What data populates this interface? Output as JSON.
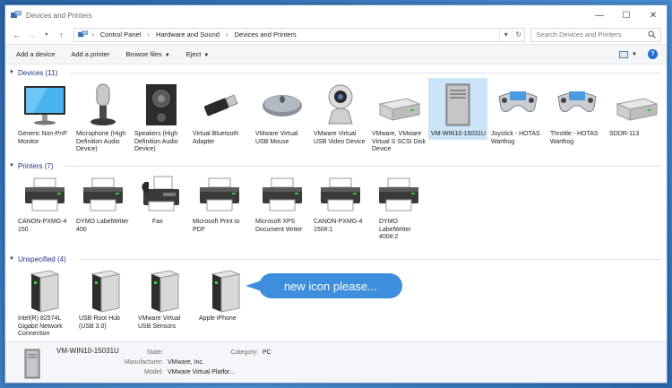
{
  "window": {
    "title": "Devices and Printers",
    "controls": {
      "minimize": "—",
      "maximize": "☐",
      "close": "✕"
    }
  },
  "address": {
    "crumbs": [
      "Control Panel",
      "Hardware and Sound",
      "Devices and Printers"
    ],
    "search_placeholder": "Search Devices and Printers"
  },
  "toolbar": {
    "add_device": "Add a device",
    "add_printer": "Add a printer",
    "browse_files": "Browse files",
    "eject": "Eject"
  },
  "groups": {
    "devices": {
      "header": "Devices (11)",
      "items": [
        {
          "label": "Generic Non-PnP Monitor",
          "icon": "monitor-icon"
        },
        {
          "label": "Microphone (High Definition Audio Device)",
          "icon": "microphone-icon"
        },
        {
          "label": "Speakers (High Definition Audio Device)",
          "icon": "speaker-icon"
        },
        {
          "label": "Virtual Bluetooth Adapter",
          "icon": "bluetooth-adapter-icon"
        },
        {
          "label": "VMware Virtual USB Mouse",
          "icon": "mouse-icon"
        },
        {
          "label": "VMware Virtual USB Video Device",
          "icon": "webcam-icon"
        },
        {
          "label": "VMware, VMware Virtual S SCSI Disk Device",
          "icon": "disk-drive-icon"
        },
        {
          "label": "VM-WIN10-15031U",
          "icon": "computer-tower-icon",
          "selected": true
        },
        {
          "label": "Joystick - HOTAS Warthog",
          "icon": "gamepad-icon"
        },
        {
          "label": "Throttle - HOTAS Warthog",
          "icon": "gamepad-icon"
        },
        {
          "label": "SDDR-113",
          "icon": "disk-drive-icon"
        }
      ]
    },
    "printers": {
      "header": "Printers (7)",
      "items": [
        {
          "label": "CANON-PXMG-4 150",
          "icon": "printer-icon"
        },
        {
          "label": "DYMO LabelWriter 400",
          "icon": "printer-icon"
        },
        {
          "label": "Fax",
          "icon": "fax-icon"
        },
        {
          "label": "Microsoft Print to PDF",
          "icon": "printer-icon"
        },
        {
          "label": "Microsoft XPS Document Writer",
          "icon": "printer-icon"
        },
        {
          "label": "CANON-PXMG-4 150#:1",
          "icon": "printer-icon"
        },
        {
          "label": "DYMO LabelWriter 400#:2",
          "icon": "printer-icon"
        }
      ]
    },
    "unspecified": {
      "header": "Unspecified (4)",
      "items": [
        {
          "label": "Intel(R) 82574L Gigabit Network Connection",
          "icon": "tower-box-icon"
        },
        {
          "label": "USB Root Hub (USB 3.0)",
          "icon": "tower-box-icon"
        },
        {
          "label": "VMware Virtual USB Sensors",
          "icon": "tower-box-icon"
        },
        {
          "label": "Apple iPhone",
          "icon": "tower-box-icon"
        }
      ]
    }
  },
  "callout": "new icon please...",
  "details": {
    "name": "VM-WIN10-15031U",
    "state_label": "State:",
    "state_value": "",
    "manufacturer_label": "Manufacturer:",
    "manufacturer_value": "VMware, Inc.",
    "model_label": "Model:",
    "model_value": "VMware Virtual Platfor...",
    "category_label": "Category:",
    "category_value": "PC"
  },
  "colors": {
    "accent": "#3e8ede",
    "group_header": "#1e3287",
    "selection": "#cce4f7"
  }
}
